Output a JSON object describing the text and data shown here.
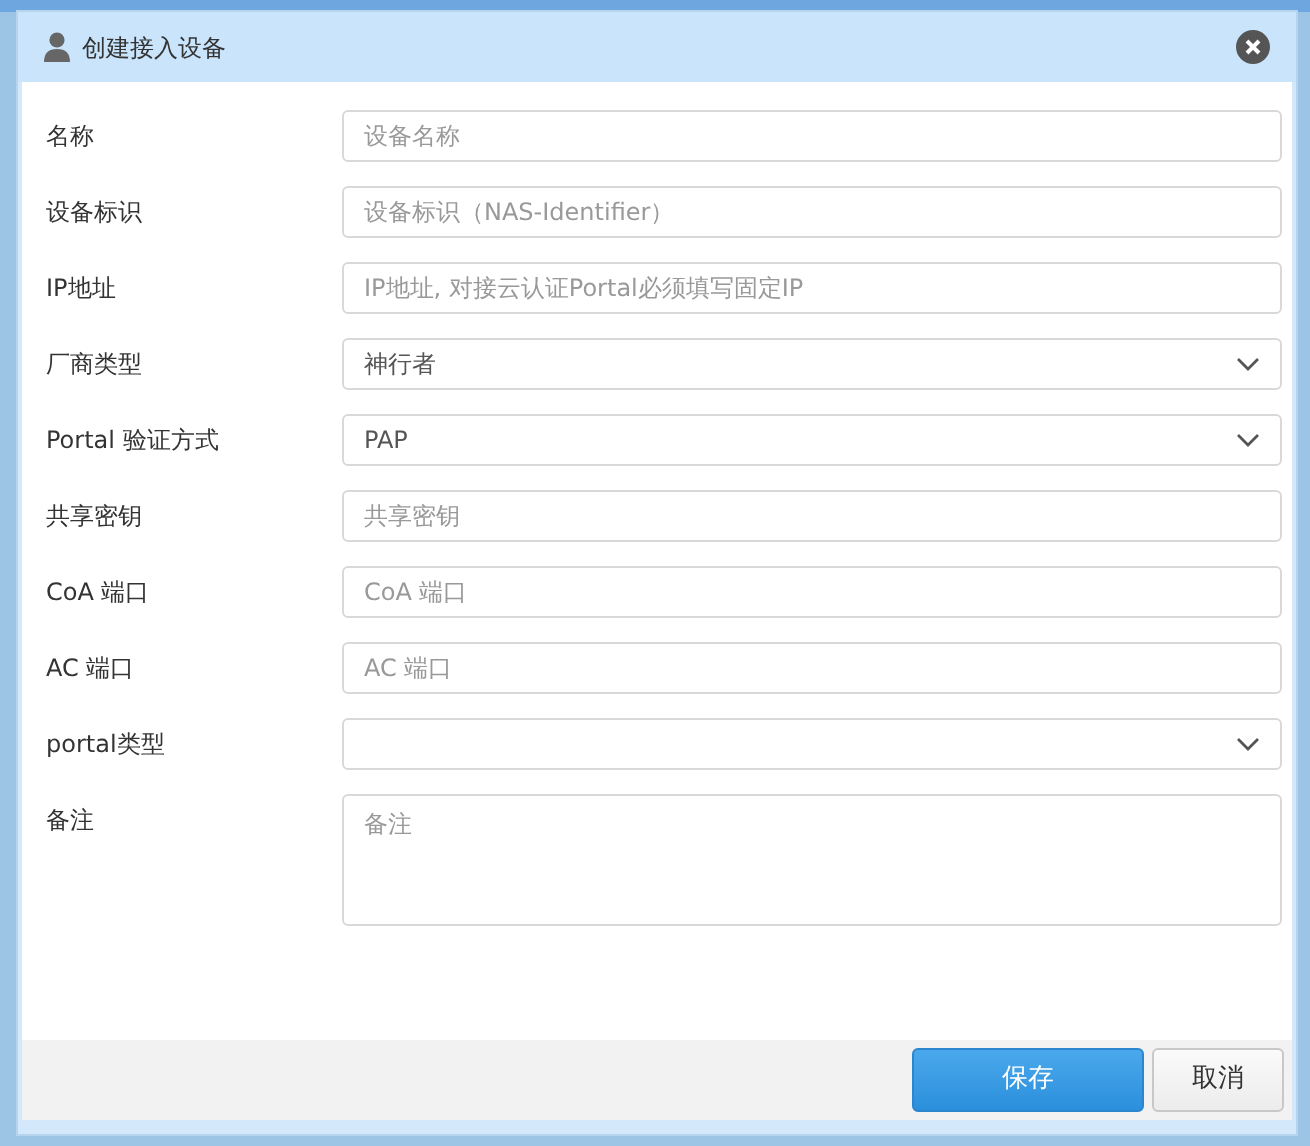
{
  "dialog": {
    "title": "创建接入设备"
  },
  "fields": [
    {
      "label": "名称",
      "kind": "text",
      "placeholder": "设备名称"
    },
    {
      "label": "设备标识",
      "kind": "text",
      "placeholder": "设备标识（NAS-Identifier）"
    },
    {
      "label": "IP地址",
      "kind": "text",
      "placeholder": "IP地址, 对接云认证Portal必须填写固定IP"
    },
    {
      "label": "厂商类型",
      "kind": "select",
      "value": "神行者"
    },
    {
      "label": "Portal 验证方式",
      "kind": "select",
      "value": "PAP"
    },
    {
      "label": "共享密钥",
      "kind": "text",
      "placeholder": "共享密钥"
    },
    {
      "label": "CoA 端口",
      "kind": "text",
      "placeholder": "CoA 端口"
    },
    {
      "label": "AC 端口",
      "kind": "text",
      "placeholder": "AC 端口"
    },
    {
      "label": "portal类型",
      "kind": "select"
    },
    {
      "label": "备注",
      "kind": "textarea",
      "placeholder": "备注"
    }
  ],
  "buttons": [
    {
      "label": "保存",
      "kind": "primary"
    },
    {
      "label": "取消",
      "kind": "secondary"
    }
  ]
}
